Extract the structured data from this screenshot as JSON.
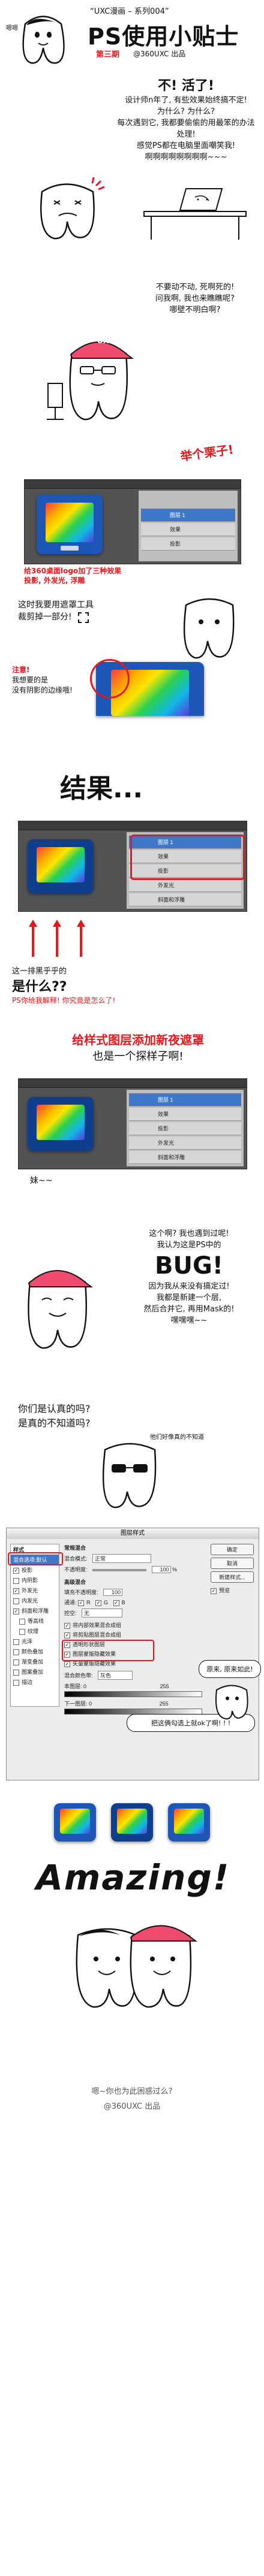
{
  "header": {
    "series": "“UXC漫画 – 系列004”",
    "title": "PS使用小贴士",
    "issue": "第三期",
    "author": "@360UXC 出品",
    "aside": "嗯嗯"
  },
  "intro": {
    "lines": [
      "不! 活了!",
      "设计师n年了, 有些效果始终搞不定!",
      "为什么? 为什么?",
      "每次遇到它, 我都要偷偷的用最笨的办法处理!",
      "感觉PS都在电脑里面嘲笑我!",
      "啊啊啊啊啊啊啊啊~~~"
    ]
  },
  "scene2": {
    "lines": [
      "不要动不动, 死啊死的!",
      "问我啊, 我也来瞧瞧呢?",
      "哪壁不明白啊?"
    ],
    "cap_text": "UXC"
  },
  "scene3": {
    "bubble": "举个栗子!",
    "caption": [
      "给360桌面logo加了三种效果",
      "投影, 外发光, 浮雕"
    ]
  },
  "scene4": {
    "lines": [
      "这时我要用遮罩工具",
      "裁剪掉一部分!"
    ],
    "note": [
      "注意!",
      "我想要的是",
      "没有阴影的边缘哦!"
    ]
  },
  "scene5": {
    "title": "结果...",
    "caption": [
      "这一排黑乎乎的",
      "是什么??",
      "PS你给我解释! 你究竟是怎么了!"
    ],
    "layers": [
      "图层 1",
      "效果",
      "投影",
      "外发光",
      "斜面和浮雕"
    ]
  },
  "scene6": {
    "title": [
      "给样式图层添加新夜遮罩",
      "也是一个探样子啊!"
    ],
    "sob": "妹~~",
    "layers": [
      "图层 1",
      "效果",
      "投影",
      "外发光",
      "斜面和浮雕"
    ]
  },
  "scene7": {
    "lines": [
      "这个啊? 我也遇到过呢!",
      "我认为这是PS中的"
    ],
    "bug": "BUG!",
    "more": [
      "因为我从来没有搞定过!",
      "我都是新建一个层,",
      "然后合并它, 再用Mask的!",
      "嘿嘿嘿~~"
    ]
  },
  "scene8": {
    "lines": [
      "你们是认真的吗?",
      "是真的不知道吗?"
    ],
    "aside": "他们好像真的不知道"
  },
  "dialog": {
    "title": "图层样式",
    "sidebar": [
      "样式",
      "混合选项:默认",
      "投影",
      "内阴影",
      "外发光",
      "内发光",
      "斜面和浮雕",
      "等高线",
      "纹理",
      "光泽",
      "颜色叠加",
      "渐变叠加",
      "图案叠加",
      "描边"
    ],
    "sections": [
      "常规混合",
      "混合模式:",
      "正常",
      "不透明度:",
      "100",
      "%",
      "高级混合",
      "填充不透明度:",
      "100",
      "通道:",
      "R",
      "G",
      "B",
      "挖空:",
      "无"
    ],
    "options": [
      "将内部效果混合成组",
      "将剪贴图层混合成组",
      "透明形状图层",
      "图层蒙版隐藏效果",
      "矢量蒙版隐藏效果"
    ],
    "blend_if": [
      "混合颜色带:",
      "灰色",
      "本图层:",
      "0",
      "255",
      "下一图层:",
      "0",
      "255"
    ],
    "buttons": [
      "确定",
      "取消",
      "新建样式...",
      "预览"
    ],
    "bubble1": "原来, 原来如此!",
    "bubble2": "把这俩勾选上就ok了啊! ! !"
  },
  "finale": {
    "title": "Amazing!",
    "footer_q": "嗯~你也为此困惑过么?",
    "footer_credit": "@360UXC 出品"
  }
}
